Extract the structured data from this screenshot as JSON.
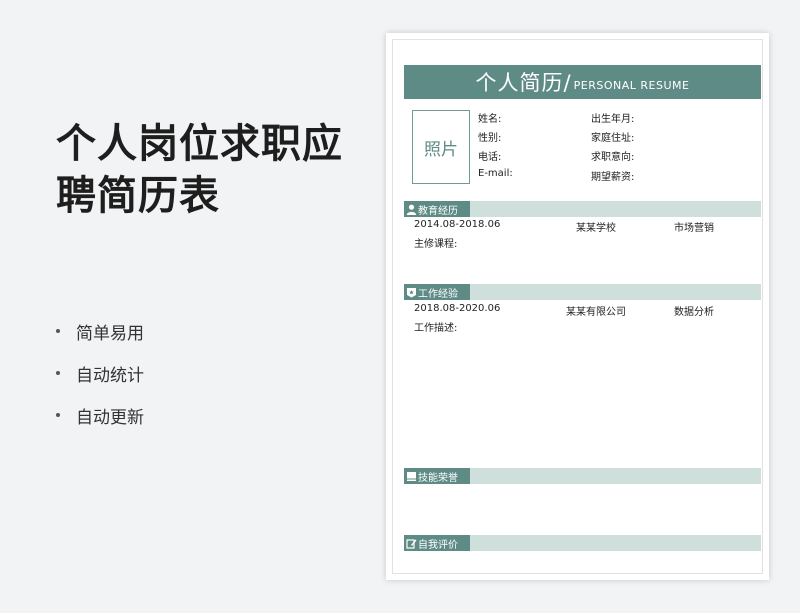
{
  "promo": {
    "title_line1": "个人岗位求职应",
    "title_line2": "聘简历表",
    "features": [
      "简单易用",
      "自动统计",
      "自动更新"
    ]
  },
  "resume": {
    "title_cn": "个人简历/",
    "title_en": "PERSONAL RESUME",
    "photo_label": "照片",
    "info": {
      "name": "姓名:",
      "birth": "出生年月:",
      "gender": "性别:",
      "address": "家庭住址:",
      "phone": "电话:",
      "intent": "求职意向:",
      "email": "E-mail:",
      "salary": "期望薪资:"
    },
    "education": {
      "label": "教育经历",
      "period": "2014.08-2018.06",
      "school": "某某学校",
      "major": "市场营销",
      "courses": "主修课程:"
    },
    "work": {
      "label": "工作经验",
      "period": "2018.08-2020.06",
      "company": "某某有限公司",
      "position": "数据分析",
      "desc": "工作描述:"
    },
    "skills": {
      "label": "技能荣誉"
    },
    "self_eval": {
      "label": "自我评价"
    }
  },
  "colors": {
    "accent": "#5f8b86",
    "accent_light": "#cfe0dc"
  }
}
